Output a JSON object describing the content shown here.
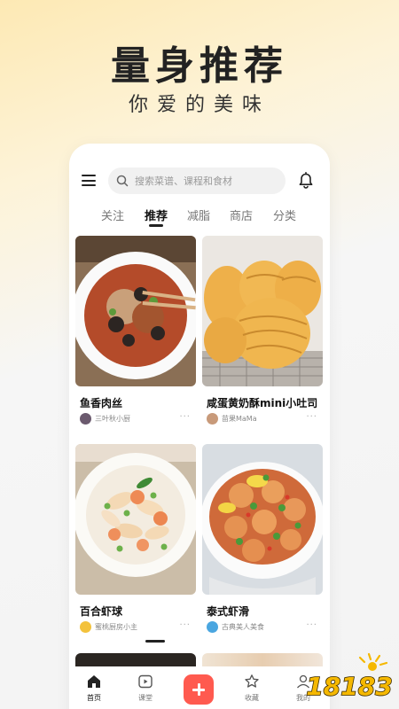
{
  "hero": {
    "title": "量身推荐",
    "subtitle": "你爱的美味"
  },
  "search": {
    "placeholder": "搜索菜谱、课程和食材"
  },
  "icons": {
    "menu": "hamburger-icon",
    "search": "search-icon",
    "notification": "bell-icon",
    "more": "more-dots-icon"
  },
  "tabs": [
    {
      "label": "关注",
      "active": false
    },
    {
      "label": "推荐",
      "active": true
    },
    {
      "label": "减脂",
      "active": false
    },
    {
      "label": "商店",
      "active": false
    },
    {
      "label": "分类",
      "active": false
    }
  ],
  "recipes": [
    {
      "title": "鱼香肉丝",
      "author": "三叶秋小厨"
    },
    {
      "title": "咸蛋黄奶酥mini小吐司",
      "author": "苗果MaMa"
    },
    {
      "title": "百合虾球",
      "author": "蜜桃厨房小主"
    },
    {
      "title": "泰式虾滑",
      "author": "古典美人美食"
    }
  ],
  "more_label": "···",
  "bottom_nav": [
    {
      "label": "首页",
      "icon": "home-icon",
      "active": true
    },
    {
      "label": "课堂",
      "icon": "play-icon",
      "active": false
    },
    {
      "label": "",
      "icon": "add-icon",
      "active": false
    },
    {
      "label": "收藏",
      "icon": "star-icon",
      "active": false
    },
    {
      "label": "我的",
      "icon": "profile-icon",
      "active": false
    }
  ],
  "watermark": "18183",
  "colors": {
    "accent": "#ff5a4f",
    "text_primary": "#111111",
    "text_secondary": "#888888",
    "watermark": "#f5b800"
  }
}
